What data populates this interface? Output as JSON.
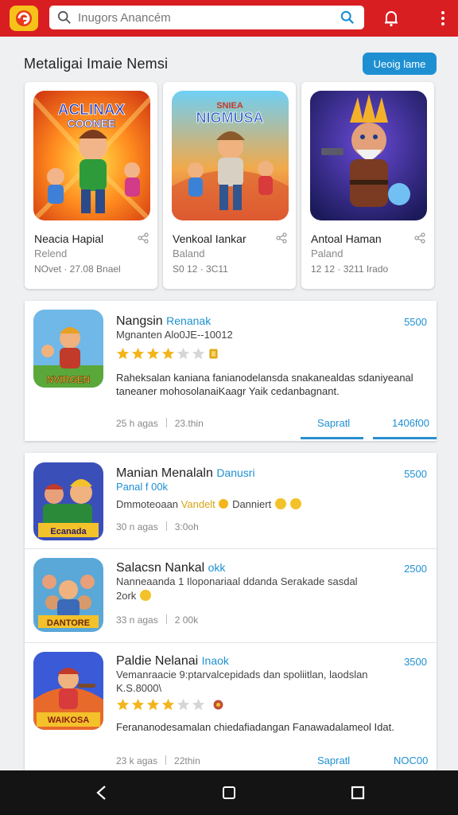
{
  "header": {
    "search_placeholder": "Inugors Anancém",
    "colors": {
      "bar": "#d91e22",
      "accent": "#1e90d2"
    }
  },
  "section": {
    "title": "Metaligai Imaie Nemsi",
    "button": "Ueoig lame"
  },
  "featured": [
    {
      "title": "Neacia Hapial",
      "subtitle": "Relend",
      "meta": "NOvet · 27.08 Bnael",
      "art_text": "ACLINAX COONEE"
    },
    {
      "title": "Venkoal Iankar",
      "subtitle": "Baland",
      "meta": "S0 12 · 3C11",
      "art_text": "NIGMUSA"
    },
    {
      "title": "Antoal Haman",
      "subtitle": "Paland",
      "meta": "12 12 · 3211 Irado",
      "art_text": ""
    }
  ],
  "list": [
    {
      "name": "Nangsin",
      "name_tag": "Renanak",
      "price": "5500",
      "line2": "Mgnanten Alo0JE--10012",
      "rating": 3.5,
      "desc": "Raheksalan kaniana  fanianodelansda snakanealdas sdaniyeanal taneaner mohosolanaiKaagr Yaik cedanbagnant.",
      "foot_left": "25 h agas",
      "foot_right": "23.thin",
      "action1": "Sapratl",
      "action2": "1406f00",
      "art_text": "NVIRGEN"
    },
    {
      "name": "Manian Menalaln",
      "name_tag": "Danusri",
      "price": "5500",
      "line2": "Panal f 00k",
      "line3": "Dmmoteoaan",
      "line3_tag": "Vandelt",
      "line3_tail": "Danniert",
      "foot_left": "30 n agas",
      "foot_right": "3:0oh",
      "art_text": "Ecanada"
    },
    {
      "name": "Salacsn Nankal",
      "name_tag": "okk",
      "price": "2500",
      "line2": "Nanneaanda 1 Iloponariaal ddanda Serakade sasdal",
      "line3": "2ork",
      "foot_left": "33 n agas",
      "foot_right": "2 00k",
      "art_text": "DANTORE"
    },
    {
      "name": "Paldie Nelanai",
      "name_tag": "Inaok",
      "price": "3500",
      "line2": "Vemanraacie 9:ptarvalcepidads dan spoliitlan, laodslan",
      "line2b": "K.S.8000\\",
      "rating": 3.5,
      "desc": "Ferananodesamalan  chiedafiadangan Fanawadalameol Idat.",
      "foot_left": "23 k agas",
      "foot_right": "22thin",
      "action1": "Sapratl",
      "action2": "NOC00",
      "art_text": "WAIKOSA"
    }
  ]
}
